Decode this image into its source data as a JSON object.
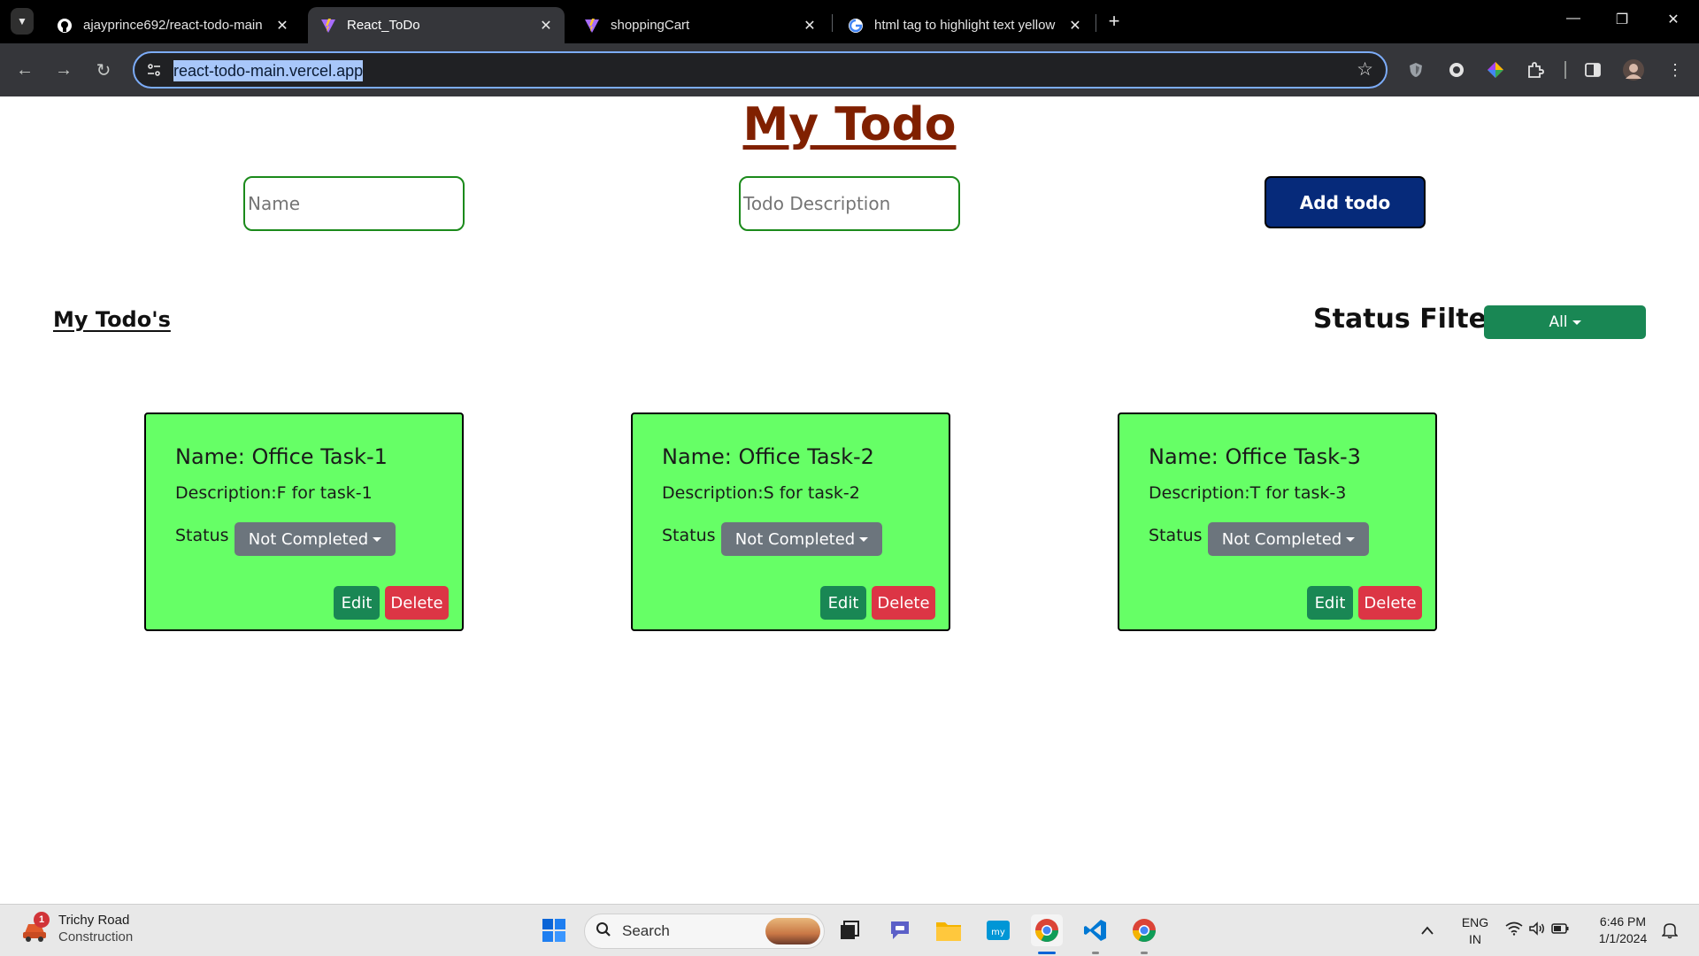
{
  "browser": {
    "tabs": [
      {
        "title": "ajayprince692/react-todo-main",
        "icon": "github-icon",
        "active": false
      },
      {
        "title": "React_ToDo",
        "icon": "vite-icon",
        "active": true
      },
      {
        "title": "shoppingCart",
        "icon": "vite-icon",
        "active": false
      },
      {
        "title": "html tag to highlight text yellow",
        "icon": "google-icon",
        "active": false
      }
    ],
    "close_glyph": "✕",
    "new_tab_glyph": "+",
    "url": "react-todo-main.vercel.app",
    "window_controls": {
      "minimize": "—",
      "restore": "❐",
      "close": "✕"
    }
  },
  "page": {
    "title": "My Todo",
    "name_placeholder": "Name",
    "description_placeholder": "Todo Description",
    "add_button": "Add todo",
    "section_title": "My Todo's",
    "filter_label": "Status Filter :",
    "filter_value": "All",
    "status_label": "Status",
    "edit_label": "Edit",
    "delete_label": "Delete",
    "todos": [
      {
        "name": "Name: Office Task-1",
        "description": "Description:F for task-1",
        "status": "Not Completed"
      },
      {
        "name": "Name: Office Task-2",
        "description": "Description:S for task-2",
        "status": "Not Completed"
      },
      {
        "name": "Name: Office Task-3",
        "description": "Description:T for task-3",
        "status": "Not Completed"
      }
    ],
    "colors": {
      "title": "#802000",
      "input_border": "#1b8a1b",
      "add_button": "#062a7a",
      "card_bg": "#66ff66",
      "filter_button": "#198754",
      "status_button": "#6c757d",
      "edit_button": "#198754",
      "delete_button": "#dc3545"
    }
  },
  "taskbar": {
    "weather": {
      "badge": "1",
      "line1": "Trichy Road",
      "line2": "Construction"
    },
    "search_label": "Search",
    "language": {
      "line1": "ENG",
      "line2": "IN"
    },
    "clock": {
      "time": "6:46 PM",
      "date": "1/1/2024"
    }
  }
}
